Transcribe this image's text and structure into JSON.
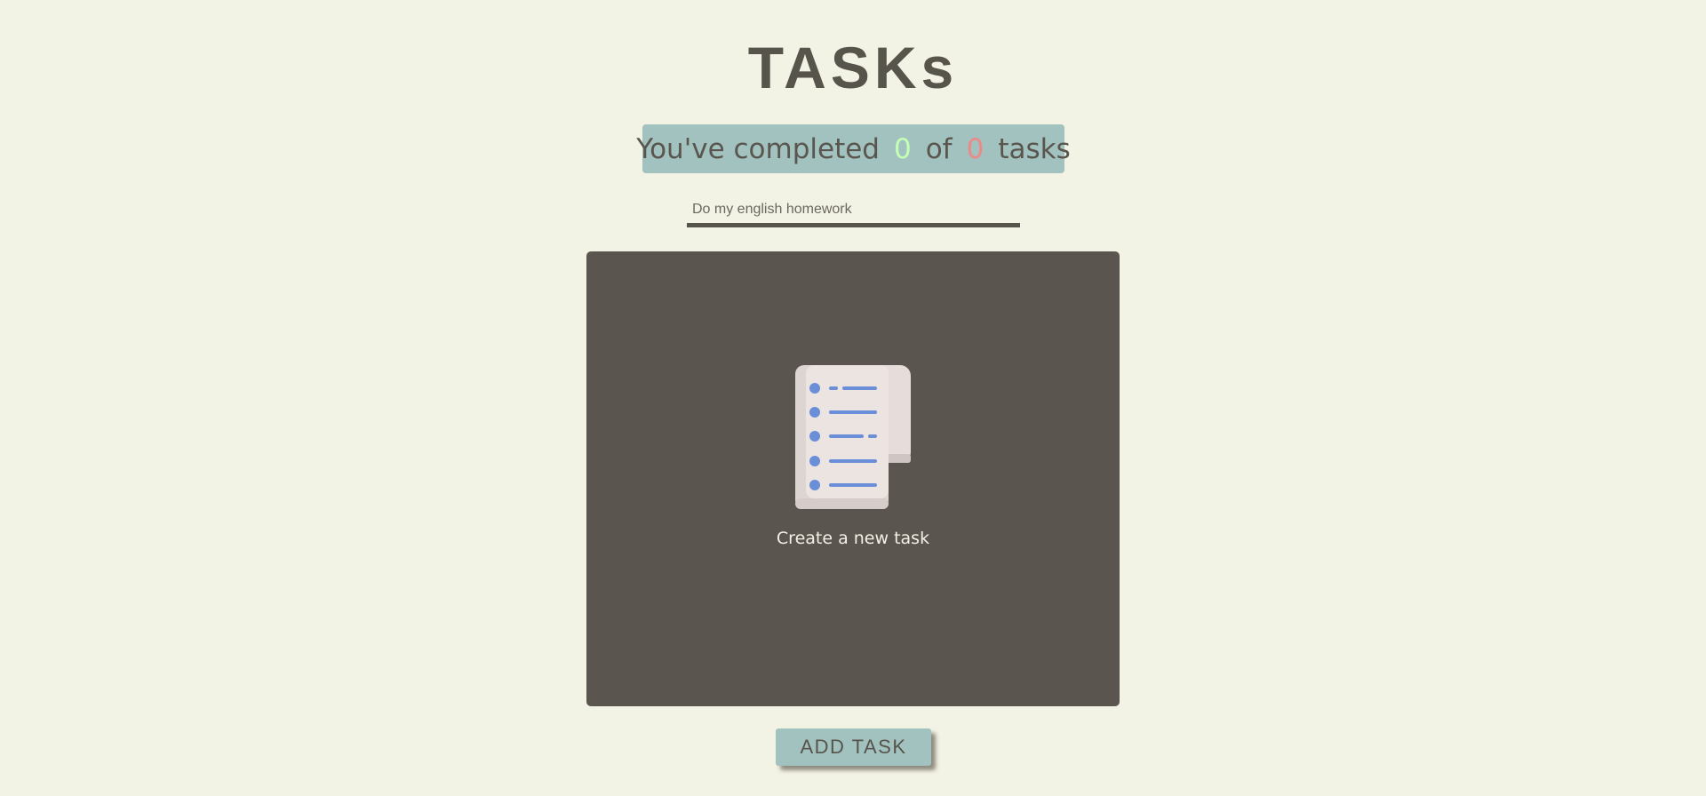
{
  "app": {
    "title": "TASKs"
  },
  "counter": {
    "prefix": "You've completed",
    "completed": "0",
    "middle": "of",
    "total": "0",
    "suffix": "tasks"
  },
  "task_input": {
    "placeholder": "Do my english homework",
    "value": ""
  },
  "task_list": {
    "empty_icon": "document-list-icon",
    "empty_message": "Create a new task"
  },
  "actions": {
    "add_label": "ADD TASK"
  },
  "colors": {
    "background": "#f3f3e5",
    "accent": "#a2c2bf",
    "panel": "#5a554f",
    "text": "#57544c",
    "completed_count": "#c4ffb7",
    "total_count": "#ec8a86",
    "icon_lines": "#6a8fd8"
  }
}
